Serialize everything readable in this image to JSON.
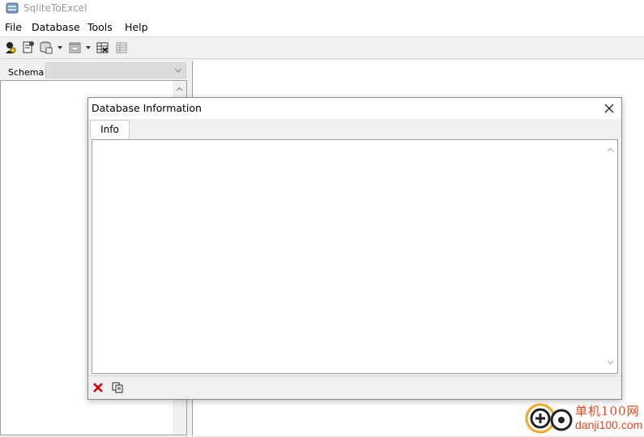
{
  "app": {
    "title": "SqliteToExcel"
  },
  "menu": {
    "items": [
      "File",
      "Database",
      "Tools",
      "Help"
    ]
  },
  "toolbar": {
    "buttons": [
      "open-database-icon",
      "connect-icon",
      "database-dropdown-icon",
      "window-dropdown-icon",
      "export-icon",
      "grid-icon"
    ]
  },
  "left_pane": {
    "schema_label": "Schema",
    "schema_value": ""
  },
  "dialog": {
    "title": "Database Information",
    "tabs": [
      {
        "label": "Info",
        "active": true
      }
    ],
    "info_text": "",
    "buttons": [
      "delete-icon",
      "copy-icon"
    ]
  },
  "watermark": {
    "text_cn": "单机100网",
    "url": "danji100.com"
  },
  "colors": {
    "window_bg": "#f0f0f0",
    "content_bg": "#ffffff",
    "border": "#a0a0a0",
    "delete_red": "#cc0000",
    "watermark_orange": "#e8451d"
  }
}
